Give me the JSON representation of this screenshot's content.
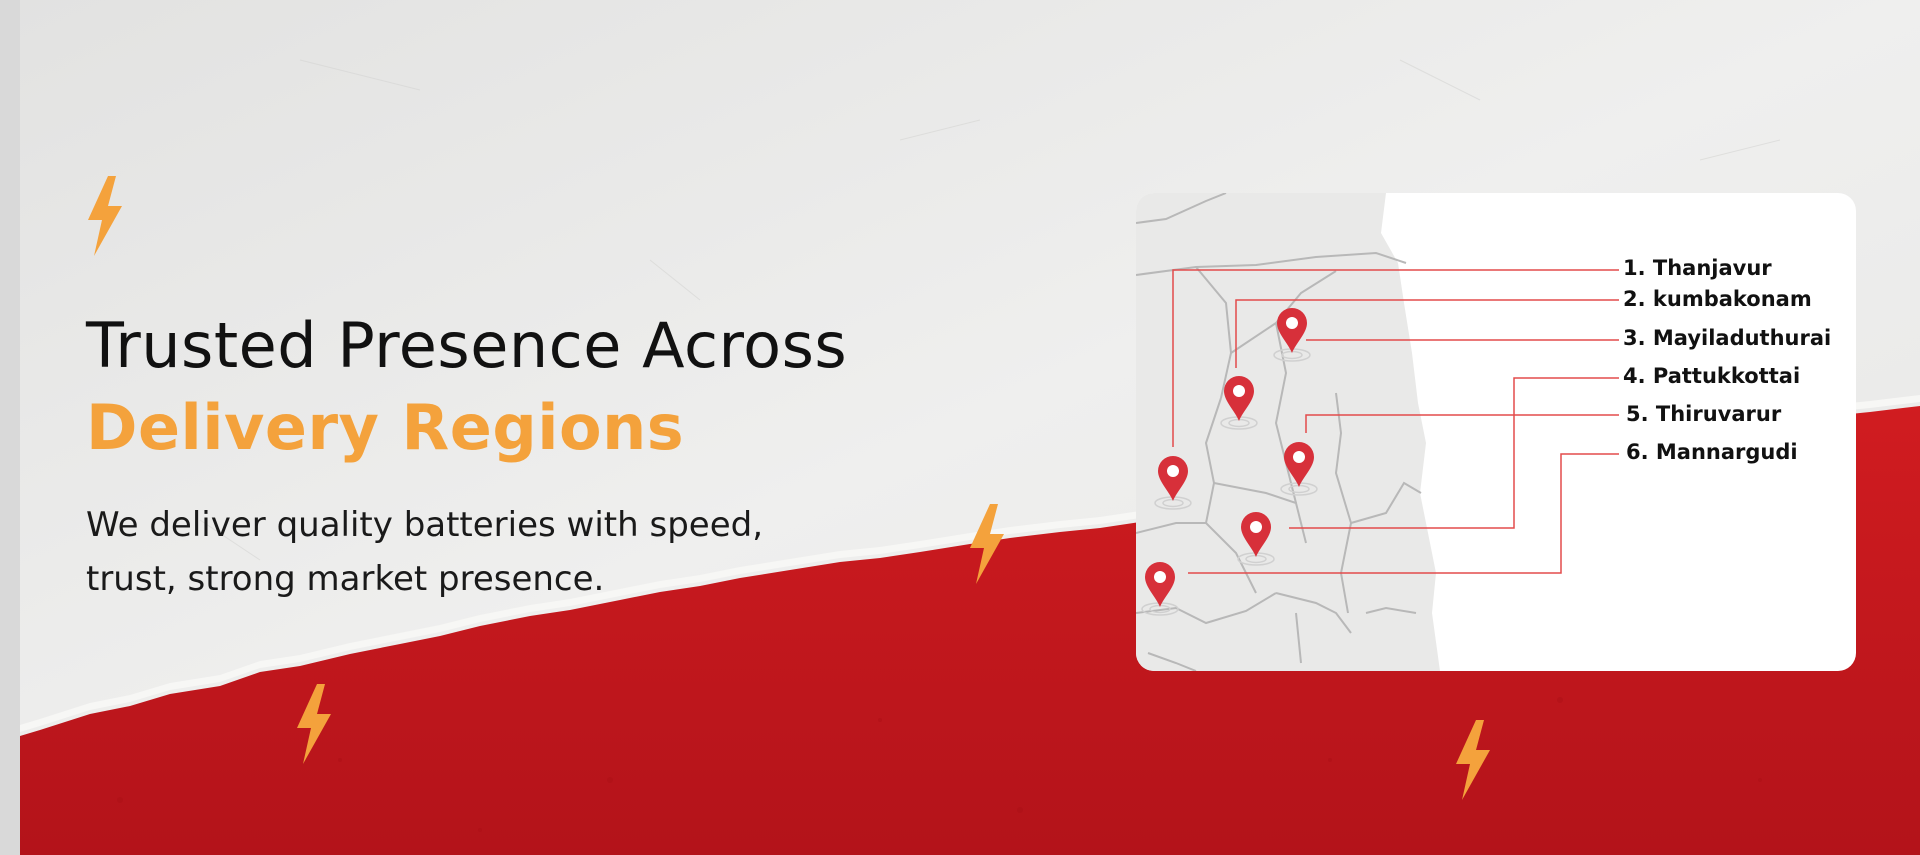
{
  "hero": {
    "title_line1": "Trusted Presence Across",
    "title_line2": "Delivery Regions",
    "subtitle_line1": "We deliver quality batteries with speed,",
    "subtitle_line2": "trust, strong market presence."
  },
  "regions": [
    {
      "label": "1. Thanjavur"
    },
    {
      "label": "2. kumbakonam"
    },
    {
      "label": "3. Mayiladuthurai"
    },
    {
      "label": "4. Pattukkottai"
    },
    {
      "label": "5. Thiruvarur"
    },
    {
      "label": "6. Mannargudi"
    }
  ],
  "colors": {
    "accent_orange": "#f4a23c",
    "brand_red": "#c8171b",
    "pin_red": "#d7303a",
    "leader_line": "#e34b4b",
    "background_grey": "#ebebea"
  },
  "icons": {
    "decor": "lightning-bolt-icon",
    "marker": "location-pin-icon"
  }
}
